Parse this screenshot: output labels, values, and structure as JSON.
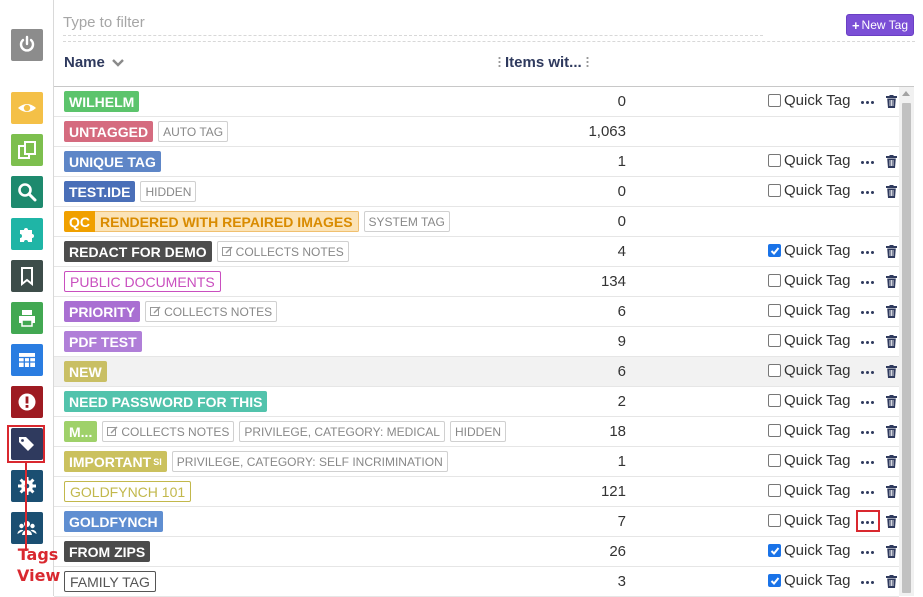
{
  "sidebar": {
    "buttons": [
      {
        "name": "power-button",
        "icon": "power-icon",
        "color": "#8c8c8c"
      },
      {
        "name": "review-button",
        "icon": "eye-icon",
        "color": "#f4c047"
      },
      {
        "name": "copy-button",
        "icon": "copy-icon",
        "color": "#7dbf4e"
      },
      {
        "name": "search-button",
        "icon": "search-icon",
        "color": "#1e8a6e"
      },
      {
        "name": "extensions-button",
        "icon": "puzzle-icon",
        "color": "#1fb5a6"
      },
      {
        "name": "bookmarks-button",
        "icon": "bookmark-icon",
        "color": "#3d4d4a"
      },
      {
        "name": "print-button",
        "icon": "print-icon",
        "color": "#42a852"
      },
      {
        "name": "table-button",
        "icon": "table-icon",
        "color": "#2a7de1"
      },
      {
        "name": "alerts-button",
        "icon": "exclamation-icon",
        "color": "#9e1b22"
      },
      {
        "name": "tags-button",
        "icon": "tags-icon",
        "color": "#2f3a5e"
      },
      {
        "name": "settings-button",
        "icon": "gear-icon",
        "color": "#1b4f72"
      },
      {
        "name": "users-button",
        "icon": "users-icon",
        "color": "#1b4f72"
      }
    ],
    "annotation_label": "Tags View"
  },
  "filter": {
    "placeholder": "Type to filter"
  },
  "new_tag_label": "New Tag",
  "columns": {
    "name": "Name",
    "items": "Items wit..."
  },
  "quick_tag_label": "Quick Tag",
  "rows": [
    {
      "tag": "WILHELM",
      "bg": "#5cc46c",
      "count": "0",
      "quick": "off"
    },
    {
      "tag": "UNTAGGED",
      "bg": "#d56b7f",
      "badges": [
        "AUTO TAG"
      ],
      "count": "1,063",
      "quick": "none"
    },
    {
      "tag": "UNIQUE TAG",
      "bg": "#5e86c7",
      "count": "1",
      "quick": "off"
    },
    {
      "tag": "TEST.IDE",
      "bg": "#4a6fb8",
      "badges": [
        "HIDDEN"
      ],
      "count": "0",
      "quick": "off"
    },
    {
      "tag": "RENDERED WITH REPAIRED IMAGES",
      "prefix": "QC",
      "badges": [
        "SYSTEM TAG"
      ],
      "count": "0",
      "quick": "none"
    },
    {
      "tag": "REDACT FOR DEMO",
      "bg": "#4d4d4d",
      "badges": [
        "COLLECTS NOTES"
      ],
      "edit_badge": true,
      "count": "4",
      "quick": "on"
    },
    {
      "tag": "PUBLIC DOCUMENTS",
      "outline": "#c94fbf",
      "count": "134",
      "quick": "off"
    },
    {
      "tag": "PRIORITY",
      "bg": "#a96fd2",
      "badges": [
        "COLLECTS NOTES"
      ],
      "edit_badge": true,
      "count": "6",
      "quick": "off"
    },
    {
      "tag": "PDF TEST",
      "bg": "#b07fd8",
      "count": "9",
      "quick": "off"
    },
    {
      "tag": "NEW",
      "bg": "#c9bf64",
      "count": "6",
      "quick": "off",
      "highlight": true
    },
    {
      "tag": "NEED PASSWORD FOR THIS",
      "bg": "#52c3ac",
      "count": "2",
      "quick": "off"
    },
    {
      "tag": "M...",
      "bg": "#9fd16a",
      "badges": [
        "COLLECTS NOTES",
        "PRIVILEGE, CATEGORY: MEDICAL",
        "HIDDEN"
      ],
      "edit_badge": true,
      "count": "18",
      "quick": "off"
    },
    {
      "tag": "IMPORTANT",
      "sub": "SI",
      "bg": "#cbc15e",
      "badges": [
        "PRIVILEGE, CATEGORY: SELF INCRIMINATION"
      ],
      "count": "1",
      "quick": "off"
    },
    {
      "tag": "GOLDFYNCH 101",
      "outline": "#c2b84c",
      "count": "121",
      "quick": "off"
    },
    {
      "tag": "GOLDFYNCH",
      "bg": "#5f8ed1",
      "count": "7",
      "quick": "off",
      "more_highlight": true
    },
    {
      "tag": "FROM ZIPS",
      "bg": "#4b4b4b",
      "count": "26",
      "quick": "on"
    },
    {
      "tag": "FAMILY TAG",
      "outline": "#555555",
      "count": "3",
      "quick": "on"
    }
  ]
}
